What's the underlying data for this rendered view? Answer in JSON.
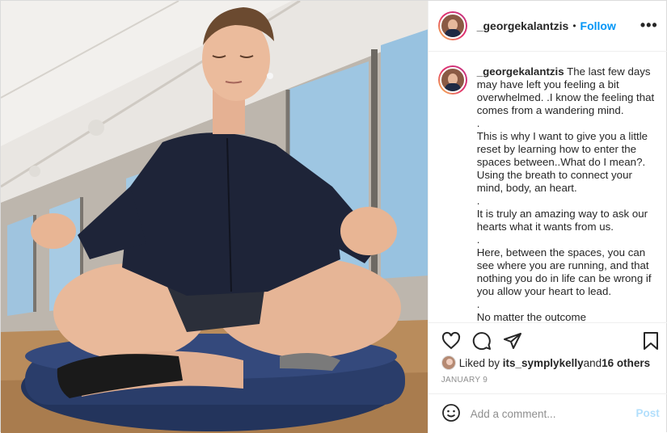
{
  "post": {
    "username": "_georgekalantzis",
    "follow_label": "Follow",
    "separator": "•",
    "more_label": "•••",
    "caption": {
      "username": "_georgekalantzis",
      "text": " The last few days may have left you feeling a bit overwhelmed. .I know the feeling that comes from a wandering mind.\n.\nThis is why I want to give you a little reset by learning how to enter the spaces between..What do I mean?. Using the breath to connect your mind, body, an heart.\n.\nIt is truly an amazing way to ask our hearts what it wants from us.\n.\nHere, between the spaces, you can see where you are running, and that nothing you do in life can be wrong if you allow your heart to lead.\n.\nNo matter the outcome"
    },
    "likes": {
      "prefix": "Liked by ",
      "user": "its_symplykelly",
      "middle": " and ",
      "others": "16 others"
    },
    "date": "JANUARY 9",
    "comment": {
      "placeholder": "Add a comment...",
      "post_label": "Post"
    },
    "colors": {
      "link_blue": "#0095f6",
      "post_disabled": "#b2dffc",
      "muted": "#8e8e8e"
    },
    "icons": [
      "heart-icon",
      "comment-icon",
      "share-icon",
      "bookmark-icon",
      "emoji-icon"
    ]
  }
}
